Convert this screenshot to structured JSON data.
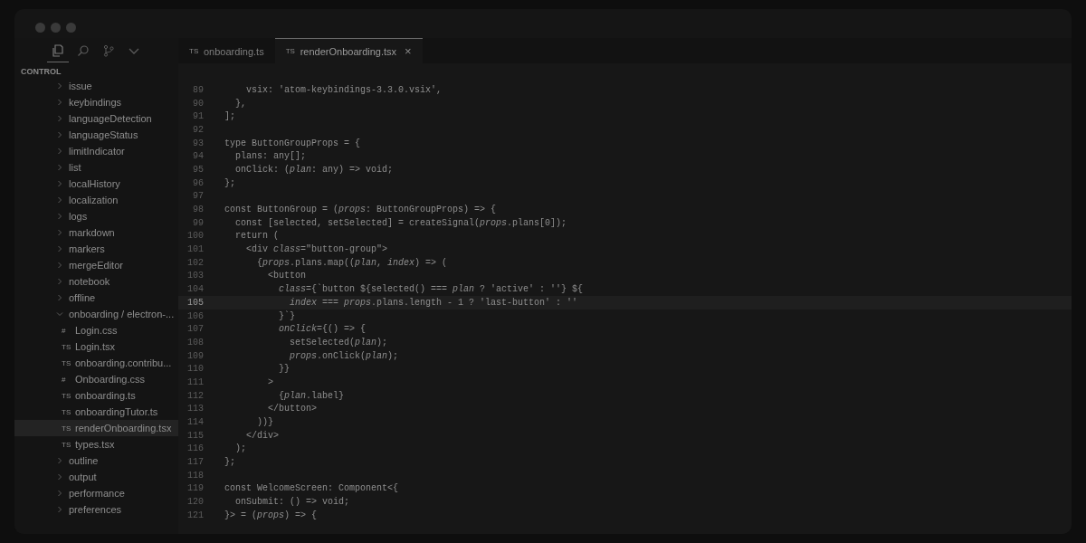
{
  "activity_bar": [
    {
      "kind": "files",
      "selected": true
    },
    {
      "kind": "search",
      "selected": false
    },
    {
      "kind": "branch",
      "selected": false
    },
    {
      "kind": "more",
      "selected": false
    }
  ],
  "tabs": [
    {
      "badge": "TS",
      "label": "onboarding.ts",
      "selected": false
    },
    {
      "badge": "TS",
      "label": "renderOnboarding.tsx",
      "selected": true,
      "close": "×"
    }
  ],
  "sidebar": {
    "title": "CONTROL",
    "items": [
      {
        "label": "issue",
        "expanded": false
      },
      {
        "label": "keybindings",
        "expanded": false
      },
      {
        "label": "languageDetection",
        "expanded": false
      },
      {
        "label": "languageStatus",
        "expanded": false
      },
      {
        "label": "limitIndicator",
        "expanded": false
      },
      {
        "label": "list",
        "expanded": false
      },
      {
        "label": "localHistory",
        "expanded": false
      },
      {
        "label": "localization",
        "expanded": false
      },
      {
        "label": "logs",
        "expanded": false
      },
      {
        "label": "markdown",
        "expanded": false
      },
      {
        "label": "markers",
        "expanded": false
      },
      {
        "label": "mergeEditor",
        "expanded": false
      },
      {
        "label": "notebook",
        "expanded": false
      },
      {
        "label": "offline",
        "expanded": false
      },
      {
        "label": "onboarding / electron-...",
        "expanded": true,
        "children": [
          {
            "badge": "#",
            "label": "Login.css",
            "selected": false
          },
          {
            "badge": "TS",
            "label": "Login.tsx",
            "selected": false
          },
          {
            "badge": "TS",
            "label": "onboarding.contribu...",
            "selected": false
          },
          {
            "badge": "#",
            "label": "Onboarding.css",
            "selected": false
          },
          {
            "badge": "TS",
            "label": "onboarding.ts",
            "selected": false
          },
          {
            "badge": "TS",
            "label": "onboardingTutor.ts",
            "selected": false
          },
          {
            "badge": "TS",
            "label": "renderOnboarding.tsx",
            "selected": true
          },
          {
            "badge": "TS",
            "label": "types.tsx",
            "selected": false
          }
        ]
      },
      {
        "label": "outline",
        "expanded": false
      },
      {
        "label": "output",
        "expanded": false
      },
      {
        "label": "performance",
        "expanded": false
      },
      {
        "label": "preferences",
        "expanded": false
      }
    ]
  },
  "editor": {
    "lines": [
      {
        "number": "89",
        "text": "    vsix: 'atom-keybindings-3.3.0.vsix',",
        "current": false
      },
      {
        "number": "90",
        "text": "  },",
        "current": false
      },
      {
        "number": "91",
        "text": "];",
        "current": false
      },
      {
        "number": "92",
        "current": false
      },
      {
        "number": "93",
        "text": "type ButtonGroupProps = {",
        "current": false
      },
      {
        "number": "94",
        "text": "  plans: any[];",
        "current": false
      },
      {
        "number": "95",
        "text": "  onClick: (*plan*: any) => void;",
        "current": false
      },
      {
        "number": "96",
        "text": "};",
        "current": false
      },
      {
        "number": "97",
        "current": false
      },
      {
        "number": "98",
        "text": "const ButtonGroup = (*props*: ButtonGroupProps) => {",
        "current": false
      },
      {
        "number": "99",
        "text": "  const [selected, setSelected] = createSignal(*props*.plans[0]);",
        "current": false
      },
      {
        "number": "100",
        "text": "  return (",
        "current": false
      },
      {
        "number": "101",
        "text": "    <div *class*=\"button-group\">",
        "current": false
      },
      {
        "number": "102",
        "text": "      {*props*.plans.map((*plan*, *index*) => (",
        "current": false
      },
      {
        "number": "103",
        "text": "        <button",
        "current": false
      },
      {
        "number": "104",
        "text": "          *class*={`button ${selected() === *plan* ? 'active' : ''} ${",
        "current": false
      },
      {
        "number": "105",
        "text": "            *index* === *props*.plans.length - 1 ? 'last-button' : ''",
        "current": true
      },
      {
        "number": "106",
        "text": "          }`}",
        "current": false
      },
      {
        "number": "107",
        "text": "          *onClick*={() => {",
        "current": false
      },
      {
        "number": "108",
        "text": "            setSelected(*plan*);",
        "current": false
      },
      {
        "number": "109",
        "text": "            *props*.onClick(*plan*);",
        "current": false
      },
      {
        "number": "110",
        "text": "          }}",
        "current": false
      },
      {
        "number": "111",
        "text": "        >",
        "current": false
      },
      {
        "number": "112",
        "text": "          {*plan*.label}",
        "current": false
      },
      {
        "number": "113",
        "text": "        </button>",
        "current": false
      },
      {
        "number": "114",
        "text": "      ))}",
        "current": false
      },
      {
        "number": "115",
        "text": "    </div>",
        "current": false
      },
      {
        "number": "116",
        "text": "  );",
        "current": false
      },
      {
        "number": "117",
        "text": "};",
        "current": false
      },
      {
        "number": "118",
        "current": false
      },
      {
        "number": "119",
        "text": "const WelcomeScreen: Component<{",
        "current": false
      },
      {
        "number": "120",
        "text": "  onSubmit: () => void;",
        "current": false
      },
      {
        "number": "121",
        "text": "}> = (*props*) => {",
        "current": false
      }
    ]
  }
}
